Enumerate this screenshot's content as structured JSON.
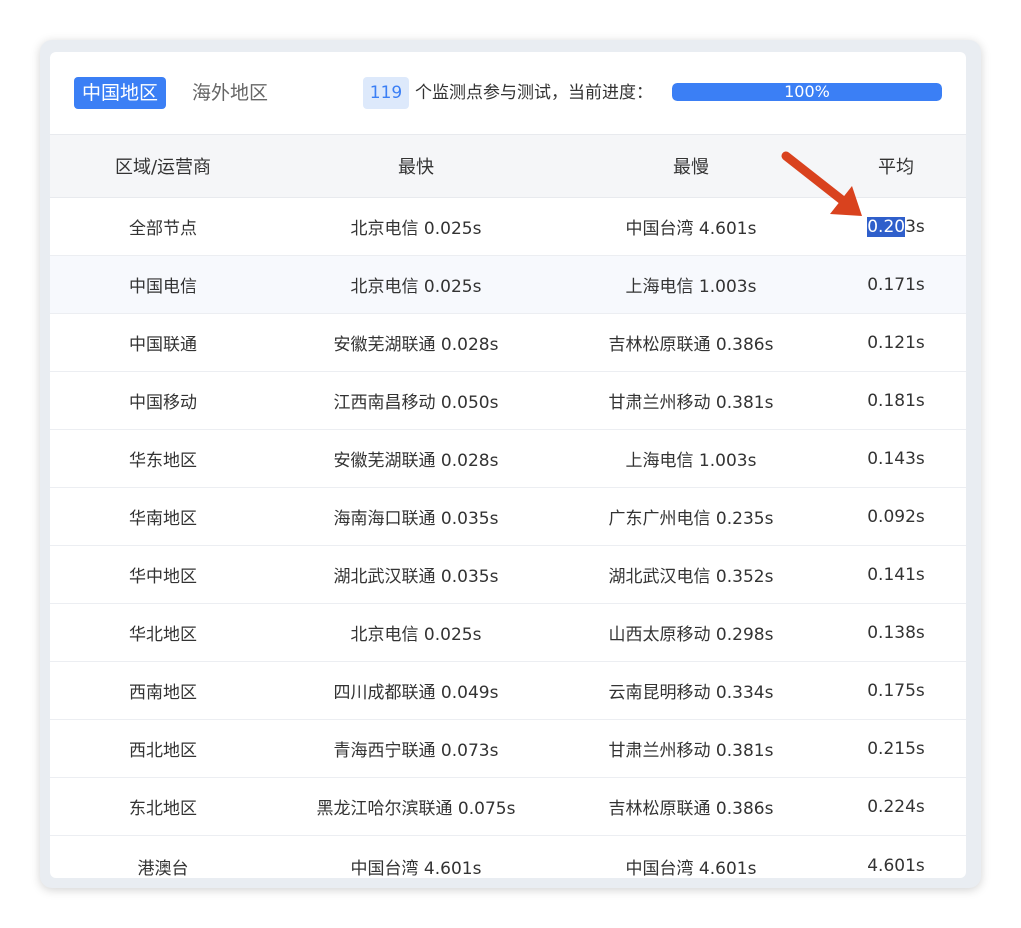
{
  "tabs": {
    "active": "中国地区",
    "inactive": "海外地区"
  },
  "status": {
    "count": "119",
    "text": "个监测点参与测试，当前进度：",
    "progress_label": "100%",
    "progress_value": 1.0
  },
  "table": {
    "headers": [
      "区域/运营商",
      "最快",
      "最慢",
      "平均"
    ],
    "rows": [
      [
        "全部节点",
        "北京电信 0.025s",
        "中国台湾 4.601s",
        "0.203s"
      ],
      [
        "中国电信",
        "北京电信 0.025s",
        "上海电信 1.003s",
        "0.171s"
      ],
      [
        "中国联通",
        "安徽芜湖联通 0.028s",
        "吉林松原联通 0.386s",
        "0.121s"
      ],
      [
        "中国移动",
        "江西南昌移动 0.050s",
        "甘肃兰州移动 0.381s",
        "0.181s"
      ],
      [
        "华东地区",
        "安徽芜湖联通 0.028s",
        "上海电信 1.003s",
        "0.143s"
      ],
      [
        "华南地区",
        "海南海口联通 0.035s",
        "广东广州电信 0.235s",
        "0.092s"
      ],
      [
        "华中地区",
        "湖北武汉联通 0.035s",
        "湖北武汉电信 0.352s",
        "0.141s"
      ],
      [
        "华北地区",
        "北京电信 0.025s",
        "山西太原移动 0.298s",
        "0.138s"
      ],
      [
        "西南地区",
        "四川成都联通 0.049s",
        "云南昆明移动 0.334s",
        "0.175s"
      ],
      [
        "西北地区",
        "青海西宁联通 0.073s",
        "甘肃兰州移动 0.381s",
        "0.215s"
      ],
      [
        "东北地区",
        "黑龙江哈尔滨联通 0.075s",
        "吉林松原联通 0.386s",
        "0.224s"
      ],
      [
        "港澳台",
        "中国台湾 4.601s",
        "中国台湾 4.601s",
        "4.601s"
      ]
    ],
    "selection": {
      "selected_part": "0.20",
      "rest": "3s"
    }
  },
  "colors": {
    "accent": "#3b7ff5",
    "selection": "#2f5fcb",
    "annotation_arrow": "#d9421e"
  },
  "icons": {
    "annotation": "arrow-pointer-icon"
  }
}
